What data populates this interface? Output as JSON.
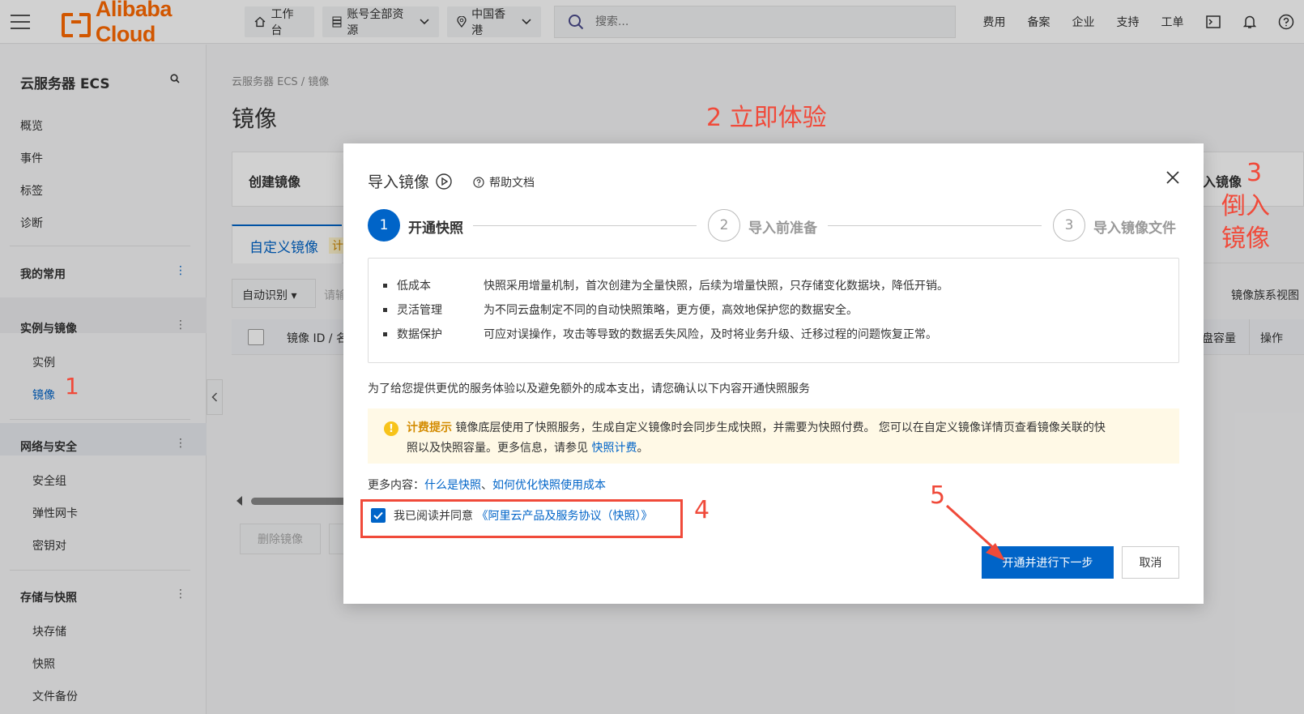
{
  "topbar": {
    "brand": "Alibaba Cloud",
    "workbench": "工作台",
    "resources": "账号全部资源",
    "region": "中国香港",
    "search_placeholder": "搜索...",
    "links": [
      "费用",
      "备案",
      "企业",
      "支持",
      "工单"
    ]
  },
  "sidebar": {
    "title": "云服务器 ECS",
    "items": [
      "概览",
      "事件",
      "标签",
      "诊断"
    ],
    "my_favorites": "我的常用",
    "groups": [
      {
        "label": "实例与镜像",
        "children": [
          "实例",
          "镜像"
        ]
      },
      {
        "label": "网络与安全",
        "children": [
          "安全组",
          "弹性网卡",
          "密钥对"
        ]
      },
      {
        "label": "存储与快照",
        "children": [
          "块存储",
          "快照",
          "文件备份"
        ]
      }
    ],
    "active_item": "镜像"
  },
  "main": {
    "breadcrumb": "云服务器 ECS  /  镜像",
    "page_title": "镜像",
    "card_create_label": "创建镜像",
    "card_import_label": "入镜像",
    "tab_custom": "自定义镜像",
    "tab_badge": "计",
    "filter_label": "自动识别",
    "filter_placeholder": "请输",
    "view_toggle": "镜像族系视图",
    "col_image_id": "镜像 ID / 名",
    "col_disk": "盘容量",
    "col_action": "操作",
    "delete_button": "删除镜像"
  },
  "modal": {
    "title": "导入镜像",
    "help": "帮助文档",
    "steps": [
      {
        "num": "1",
        "label": "开通快照",
        "active": true
      },
      {
        "num": "2",
        "label": "导入前准备",
        "active": false
      },
      {
        "num": "3",
        "label": "导入镜像文件",
        "active": false
      }
    ],
    "features": [
      {
        "name": "低成本",
        "desc": "快照采用增量机制，首次创建为全量快照，后续为增量快照，只存储变化数据块，降低开销。"
      },
      {
        "name": "灵活管理",
        "desc": "为不同云盘制定不同的自动快照策略，更方便，高效地保护您的数据安全。"
      },
      {
        "name": "数据保护",
        "desc": "可应对误操作，攻击等导致的数据丢失风险，及时将业务升级、迁移过程的问题恢复正常。"
      }
    ],
    "notice": "为了给您提供更优的服务体验以及避免额外的成本支出，请您确认以下内容开通快照服务",
    "warn_tag": "计费提示",
    "warn_text_1": "镜像底层使用了快照服务，生成自定义镜像时会同步生成快照，并需要为快照付费。 您可以在自定义镜像详情页查看镜像关联的快",
    "warn_text_2": "照以及快照容量。更多信息，请参见",
    "warn_link": "快照计费",
    "warn_end": "。",
    "more_label": "更多内容：",
    "more_link_1": "什么是快照",
    "more_sep": "、",
    "more_link_2": "如何优化快照使用成本",
    "agree_text": "我已阅读并同意",
    "agree_link": "《阿里云产品及服务协议（快照）》",
    "agree_checked": true,
    "primary_button": "开通并进行下一步",
    "cancel_button": "取消"
  },
  "annotations": {
    "a1": "1",
    "a2": "2 立即体验",
    "a3": "3",
    "a3b": "倒入镜像",
    "a4": "4",
    "a5": "5"
  },
  "colors": {
    "brand": "#ff6a00",
    "primary": "#0064c8",
    "annotation": "#f04a3a",
    "warn_bg": "#fff9e6"
  }
}
